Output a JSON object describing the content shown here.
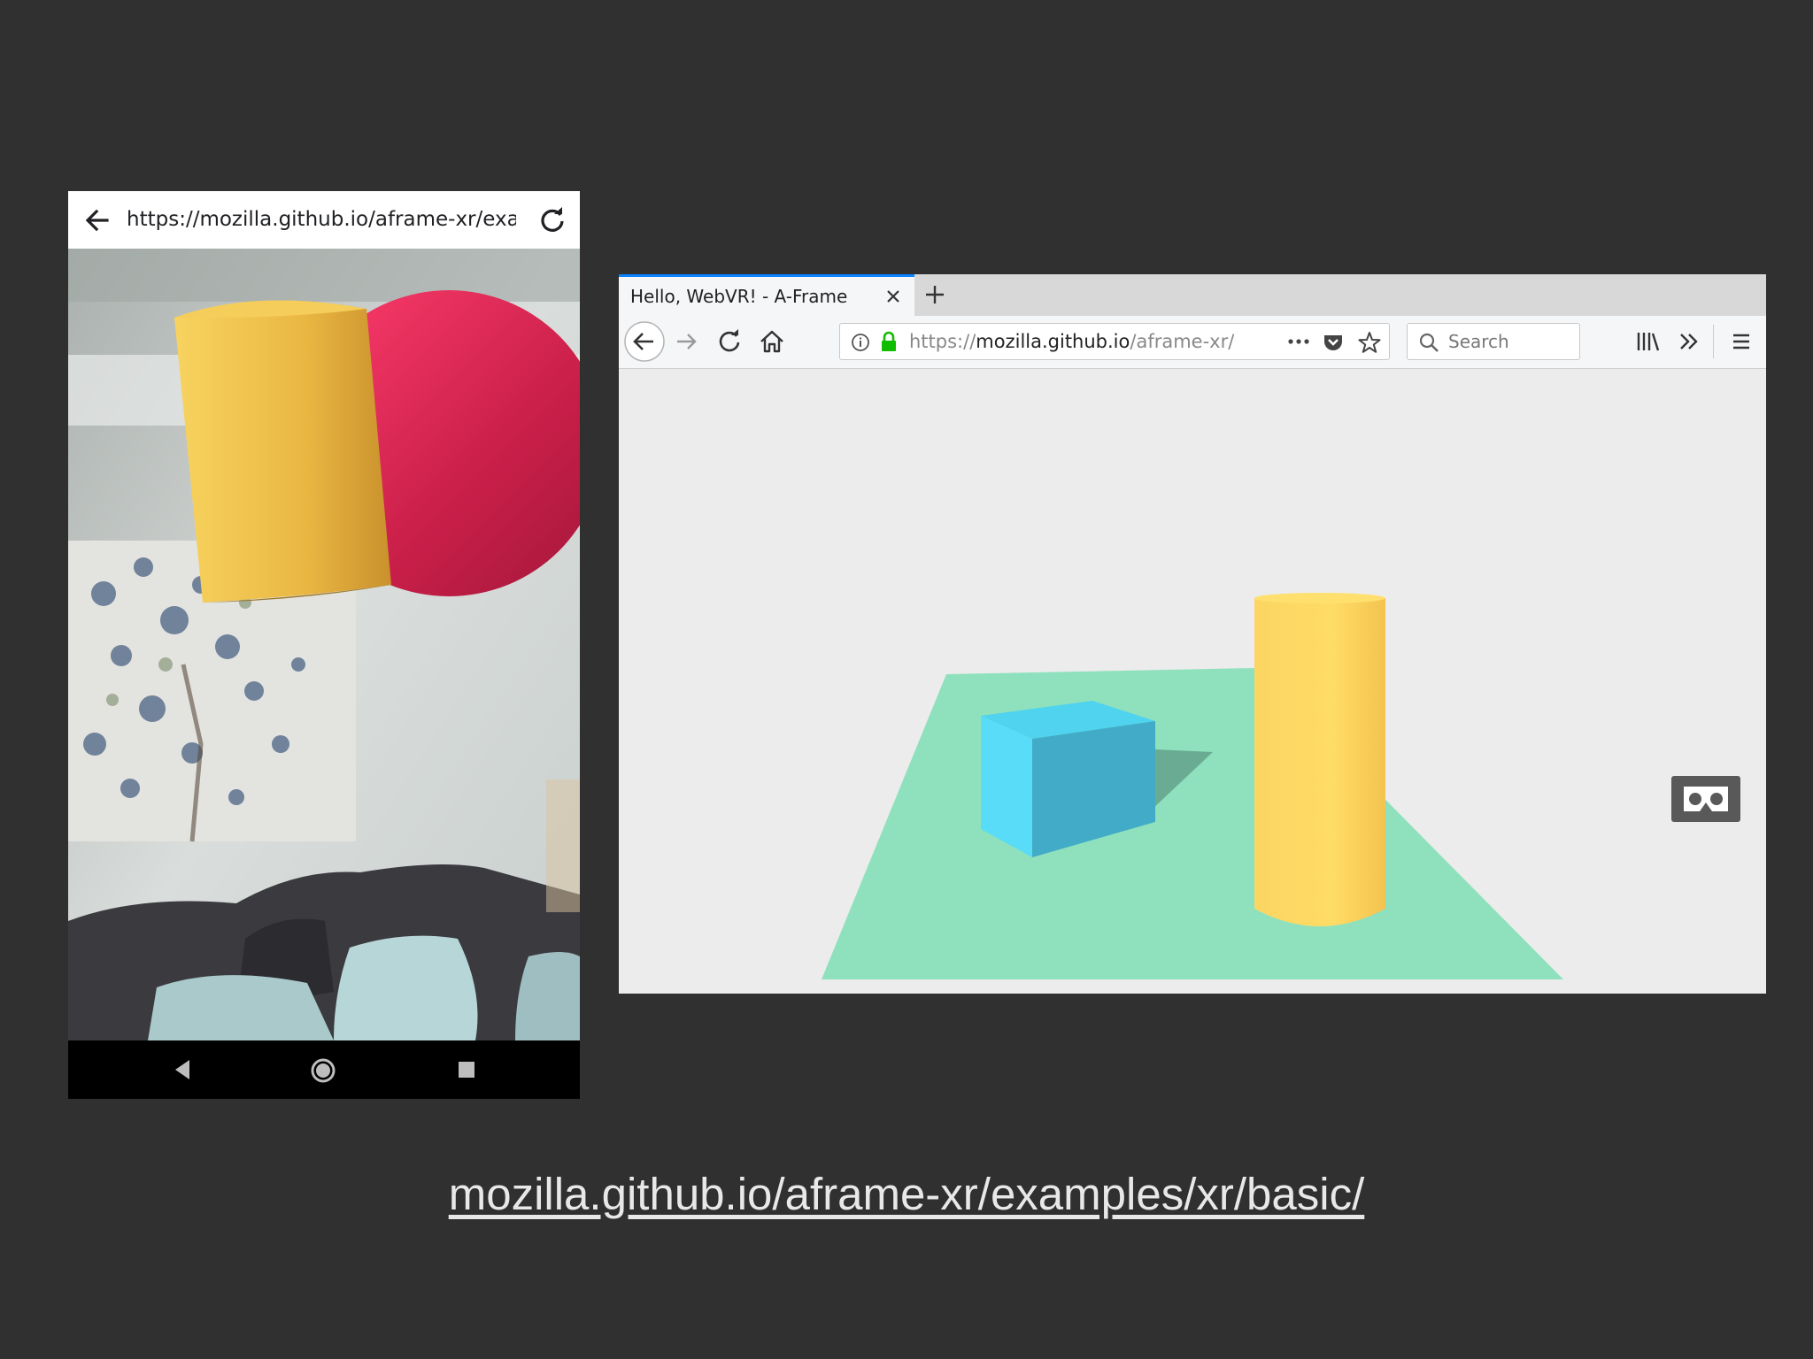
{
  "phone": {
    "url": "https://mozilla.github.io/aframe-xr/exam",
    "icons": [
      "back-arrow-icon",
      "reload-icon",
      "nav-back-icon",
      "nav-home-icon",
      "nav-recents-icon"
    ]
  },
  "browser": {
    "tab_title": "Hello, WebVR! - A-Frame",
    "url_scheme": "https://",
    "url_domain": "mozilla.github.io",
    "url_path": "/aframe-xr/",
    "search_placeholder": "Search",
    "accent_color": "#0a84ff"
  },
  "caption": {
    "link_text": "mozilla.github.io/aframe-xr/examples/xr/basic/"
  }
}
